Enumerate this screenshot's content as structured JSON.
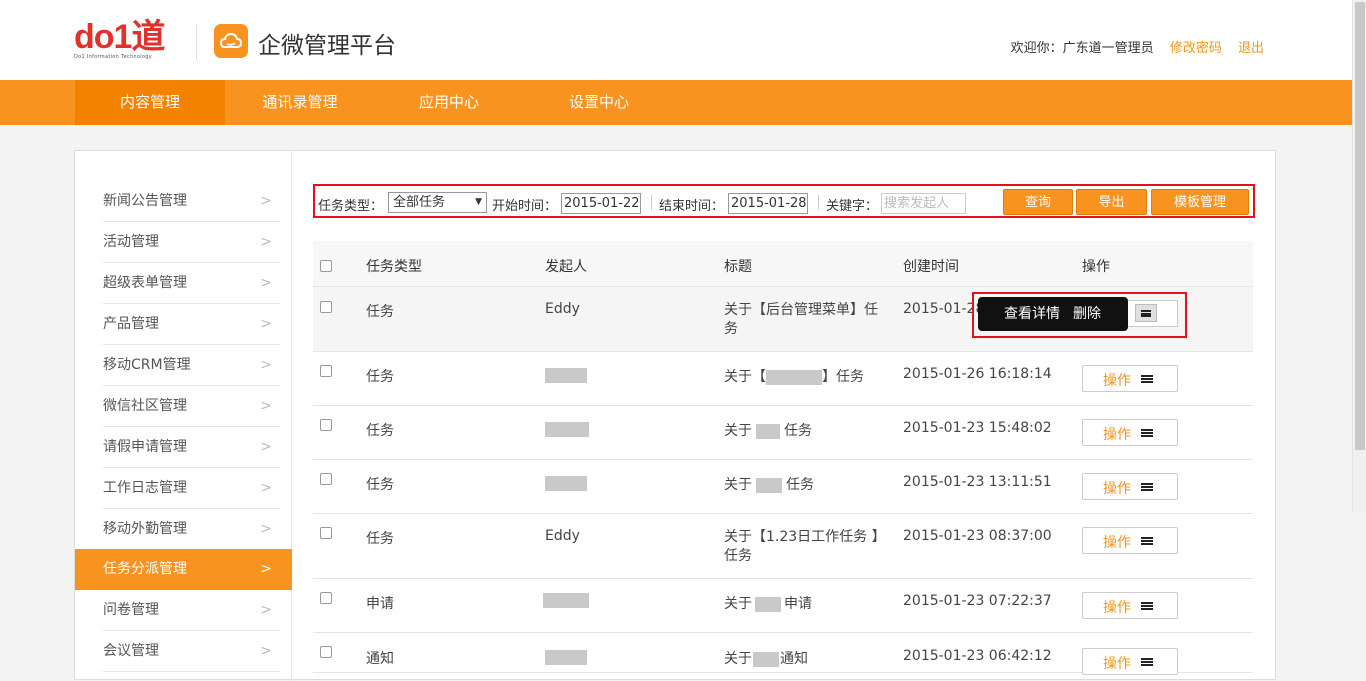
{
  "header": {
    "brand_mark": "do1道",
    "brand_sub": "Do1 Information Technology",
    "app_title": "企微管理平台",
    "welcome": "欢迎你：广东道一管理员",
    "change_password": "修改密码",
    "logout": "退出"
  },
  "nav": [
    "内容管理",
    "通讯录管理",
    "应用中心",
    "设置中心"
  ],
  "sidebar": [
    "新闻公告管理",
    "活动管理",
    "超级表单管理",
    "产品管理",
    "移动CRM管理",
    "微信社区管理",
    "请假申请管理",
    "工作日志管理",
    "移动外勤管理",
    "任务分派管理",
    "问卷管理",
    "会议管理"
  ],
  "sidebar_active": "任务分派管理",
  "filter": {
    "type_label": "任务类型：",
    "type_value": "全部任务",
    "start_label": "开始时间：",
    "start_value": "2015-01-22",
    "end_label": "结束时间：",
    "end_value": "2015-01-28",
    "keyword_label": "关键字：",
    "keyword_placeholder": "搜索发起人",
    "query_btn": "查询",
    "export_btn": "导出",
    "template_btn": "模板管理"
  },
  "table": {
    "headers": [
      "任务类型",
      "发起人",
      "标题",
      "创建时间",
      "操作"
    ],
    "op_label": "操作",
    "rows": [
      {
        "type": "任务",
        "sender": "Eddy",
        "title": "关于【后台管理菜单】任务",
        "time": "2015-01-28"
      },
      {
        "type": "任务",
        "sender": "",
        "title": "关于【        】任务",
        "time": "2015-01-26 16:18:14"
      },
      {
        "type": "任务",
        "sender": "",
        "title": "关于      任务",
        "time": "2015-01-23 15:48:02"
      },
      {
        "type": "任务",
        "sender": "",
        "title": "关于      任务",
        "time": "2015-01-23 13:11:51"
      },
      {
        "type": "任务",
        "sender": "Eddy",
        "title": "关于【1.23日工作任务 】任务",
        "time": "2015-01-23 08:37:00"
      },
      {
        "type": "申请",
        "sender": "",
        "title": "关于      申请",
        "time": "2015-01-23 07:22:37"
      },
      {
        "type": "通知",
        "sender": "",
        "title": "关于      通知",
        "time": "2015-01-23 06:42:12"
      }
    ]
  },
  "popup": {
    "view_detail": "查看详情",
    "delete": "删除"
  }
}
